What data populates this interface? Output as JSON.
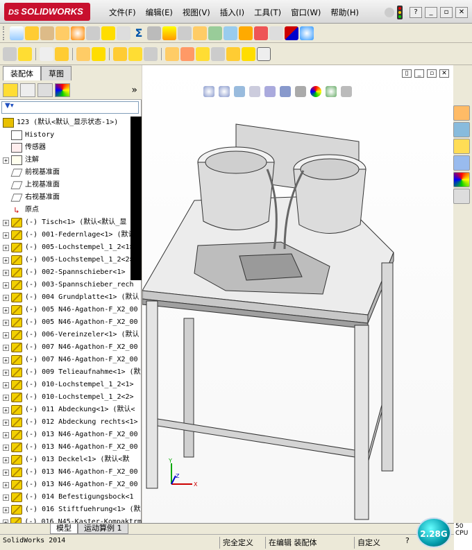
{
  "app": {
    "brand": "SOLIDWORKS",
    "brand_prefix": "DS"
  },
  "menu": [
    "文件(F)",
    "编辑(E)",
    "视图(V)",
    "插入(I)",
    "工具(T)",
    "窗口(W)",
    "帮助(H)"
  ],
  "tabs": {
    "assembly": "装配体",
    "sketch": "草图"
  },
  "tree": {
    "root": "123  (默认<默认_显示状态-1>)",
    "history": "History",
    "sensors": "传感器",
    "annotations": "注解",
    "front_plane": "前视基准面",
    "top_plane": "上视基准面",
    "right_plane": "右视基准面",
    "origin": "原点",
    "components": [
      "(-) Tisch<1> (默认<默认_显",
      "(-) 001-Federnlage<1> (默认",
      "(-) 005-Lochstempel_1_2<1>",
      "(-) 005-Lochstempel_1_2<2>",
      "(-) 002-Spannschieber<1> (默",
      "(-) 003-Spannschieber_rech",
      "(-) 004 Grundplatte<1> (默认",
      "(-) 005 N46-Agathon-F_X2_00",
      "(-) 005 N46-Agathon-F_X2_00",
      "(-) 006-Vereinzeler<1> (默认",
      "(-) 007 N46-Agathon-F_X2_00",
      "(-) 007 N46-Agathon-F_X2_00",
      "(-) 009 Telieaufnahme<1> (默",
      "(-) 010-Lochstempel_1_2<1>",
      "(-) 010-Lochstempel_1_2<2>",
      "(-) 011 Abdeckung<1> (默认<",
      "(-) 012 Abdeckung rechts<1>",
      "(-) 013 N46-Agathon-F_X2_00",
      "(-) 013 N46-Agathon-F_X2_00",
      "(-) 013 Deckel<1> (默认<默",
      "(-) 013 N46-Agathon-F_X2_00",
      "(-) 013 N46-Agathon-F_X2_00",
      "(-) 014 Befestigungsbock<1",
      "(-) 016 Stiftfuehrung<1> (默",
      "(-) 016 N45-Kaster-Kompaktrm"
    ]
  },
  "bottom_tabs": {
    "model": "模型",
    "motion": "运动算例 1"
  },
  "status": {
    "app_version": "SolidWorks 2014",
    "fully_defined": "完全定义",
    "editing": "在编辑 装配体",
    "custom": "自定义",
    "perf_value": "2.28G",
    "perf_a": "50",
    "perf_b": "CPU"
  },
  "axis": {
    "x": "X",
    "y": "Y",
    "z": "Z"
  },
  "colors": {
    "brand_red": "#c8102e",
    "component_yellow": "#f2d000",
    "model_gray": "#c8c8c8"
  }
}
